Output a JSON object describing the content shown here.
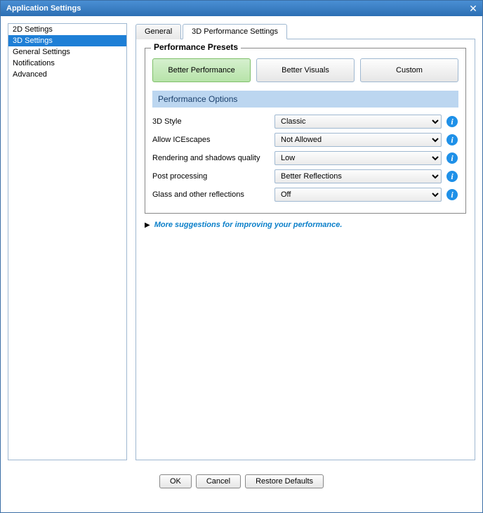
{
  "title": "Application Settings",
  "sidebar": {
    "items": [
      {
        "label": "2D Settings"
      },
      {
        "label": "3D Settings"
      },
      {
        "label": "General Settings"
      },
      {
        "label": "Notifications"
      },
      {
        "label": "Advanced"
      }
    ],
    "selectedIndex": 1
  },
  "tabs": {
    "items": [
      {
        "label": "General"
      },
      {
        "label": "3D Performance Settings"
      }
    ],
    "activeIndex": 1
  },
  "presets": {
    "legend": "Performance Presets",
    "buttons": [
      {
        "label": "Better Performance"
      },
      {
        "label": "Better Visuals"
      },
      {
        "label": "Custom"
      }
    ],
    "activeIndex": 0
  },
  "optionsHeader": "Performance Options",
  "options": [
    {
      "label": "3D Style",
      "value": "Classic"
    },
    {
      "label": "Allow ICEscapes",
      "value": "Not Allowed"
    },
    {
      "label": "Rendering and shadows quality",
      "value": "Low"
    },
    {
      "label": "Post processing",
      "value": "Better Reflections"
    },
    {
      "label": "Glass and other reflections",
      "value": "Off"
    }
  ],
  "suggestions": "More suggestions for improving your performance.",
  "buttons": {
    "ok": "OK",
    "cancel": "Cancel",
    "restore": "Restore Defaults"
  }
}
